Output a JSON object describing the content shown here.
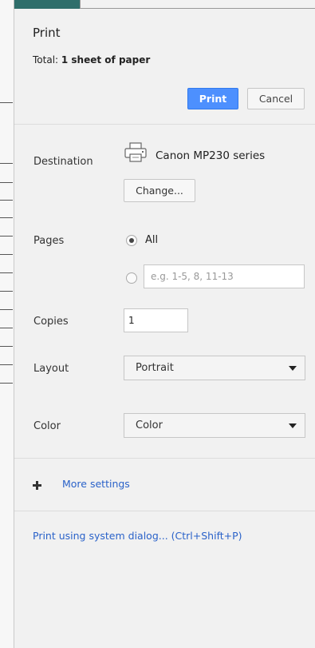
{
  "dialog": {
    "title": "Print",
    "summary_prefix": "Total: ",
    "summary_value": "1 sheet of paper",
    "print_label": "Print",
    "cancel_label": "Cancel"
  },
  "destination": {
    "label": "Destination",
    "printer_name": "Canon MP230 series",
    "change_label": "Change..."
  },
  "pages": {
    "label": "Pages",
    "all_label": "All",
    "custom_placeholder": "e.g. 1-5, 8, 11-13",
    "selected": "all"
  },
  "copies": {
    "label": "Copies",
    "value": "1"
  },
  "layout": {
    "label": "Layout",
    "value": "Portrait"
  },
  "color": {
    "label": "Color",
    "value": "Color"
  },
  "more_settings": "More settings",
  "system_dialog_link": "Print using system dialog... (Ctrl+Shift+P)",
  "colors": {
    "accent": "#4d90fe",
    "link": "#2a62c9",
    "panel_bg": "#f1f1f1",
    "desktop_bg": "#2f6e6b"
  }
}
